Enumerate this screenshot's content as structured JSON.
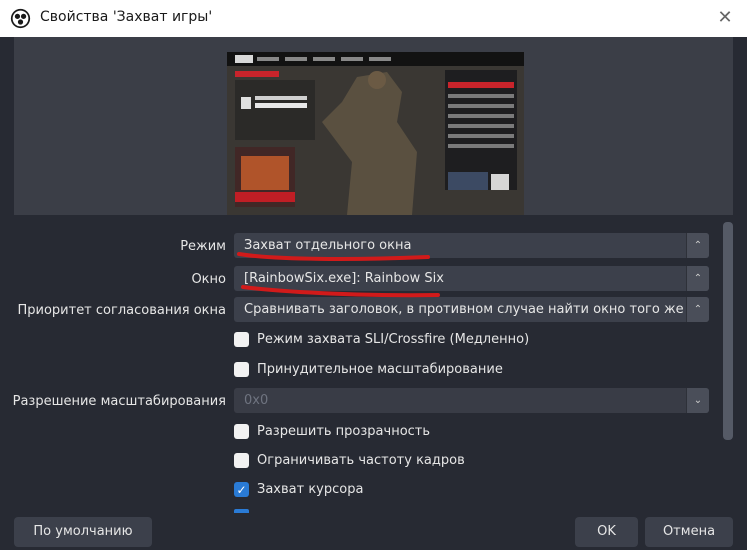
{
  "window": {
    "title": "Свойства 'Захват игры'"
  },
  "fields": {
    "mode": {
      "label": "Режим",
      "value": "Захват отдельного окна"
    },
    "window": {
      "label": "Окно",
      "value": "[RainbowSix.exe]: Rainbow Six"
    },
    "priority": {
      "label": "Приоритет согласования окна",
      "value": "Сравнивать заголовок, в противном случае найти окно того же исп"
    },
    "scale_res": {
      "label": "Разрешение масштабирования",
      "value": "0x0"
    }
  },
  "checkboxes": [
    {
      "label": "Режим захвата SLI/Crossfire (Медленно)",
      "checked": false
    },
    {
      "label": "Принудительное масштабирование",
      "checked": false
    },
    {
      "label": "Разрешить прозрачность",
      "checked": false
    },
    {
      "label": "Ограничивать частоту кадров",
      "checked": false
    },
    {
      "label": "Захват курсора",
      "checked": true
    }
  ],
  "buttons": {
    "defaults": "По умолчанию",
    "ok": "OK",
    "cancel": "Отмена"
  },
  "colors": {
    "annotation": "#d11a1a",
    "check_accent": "#2a7bd6"
  }
}
